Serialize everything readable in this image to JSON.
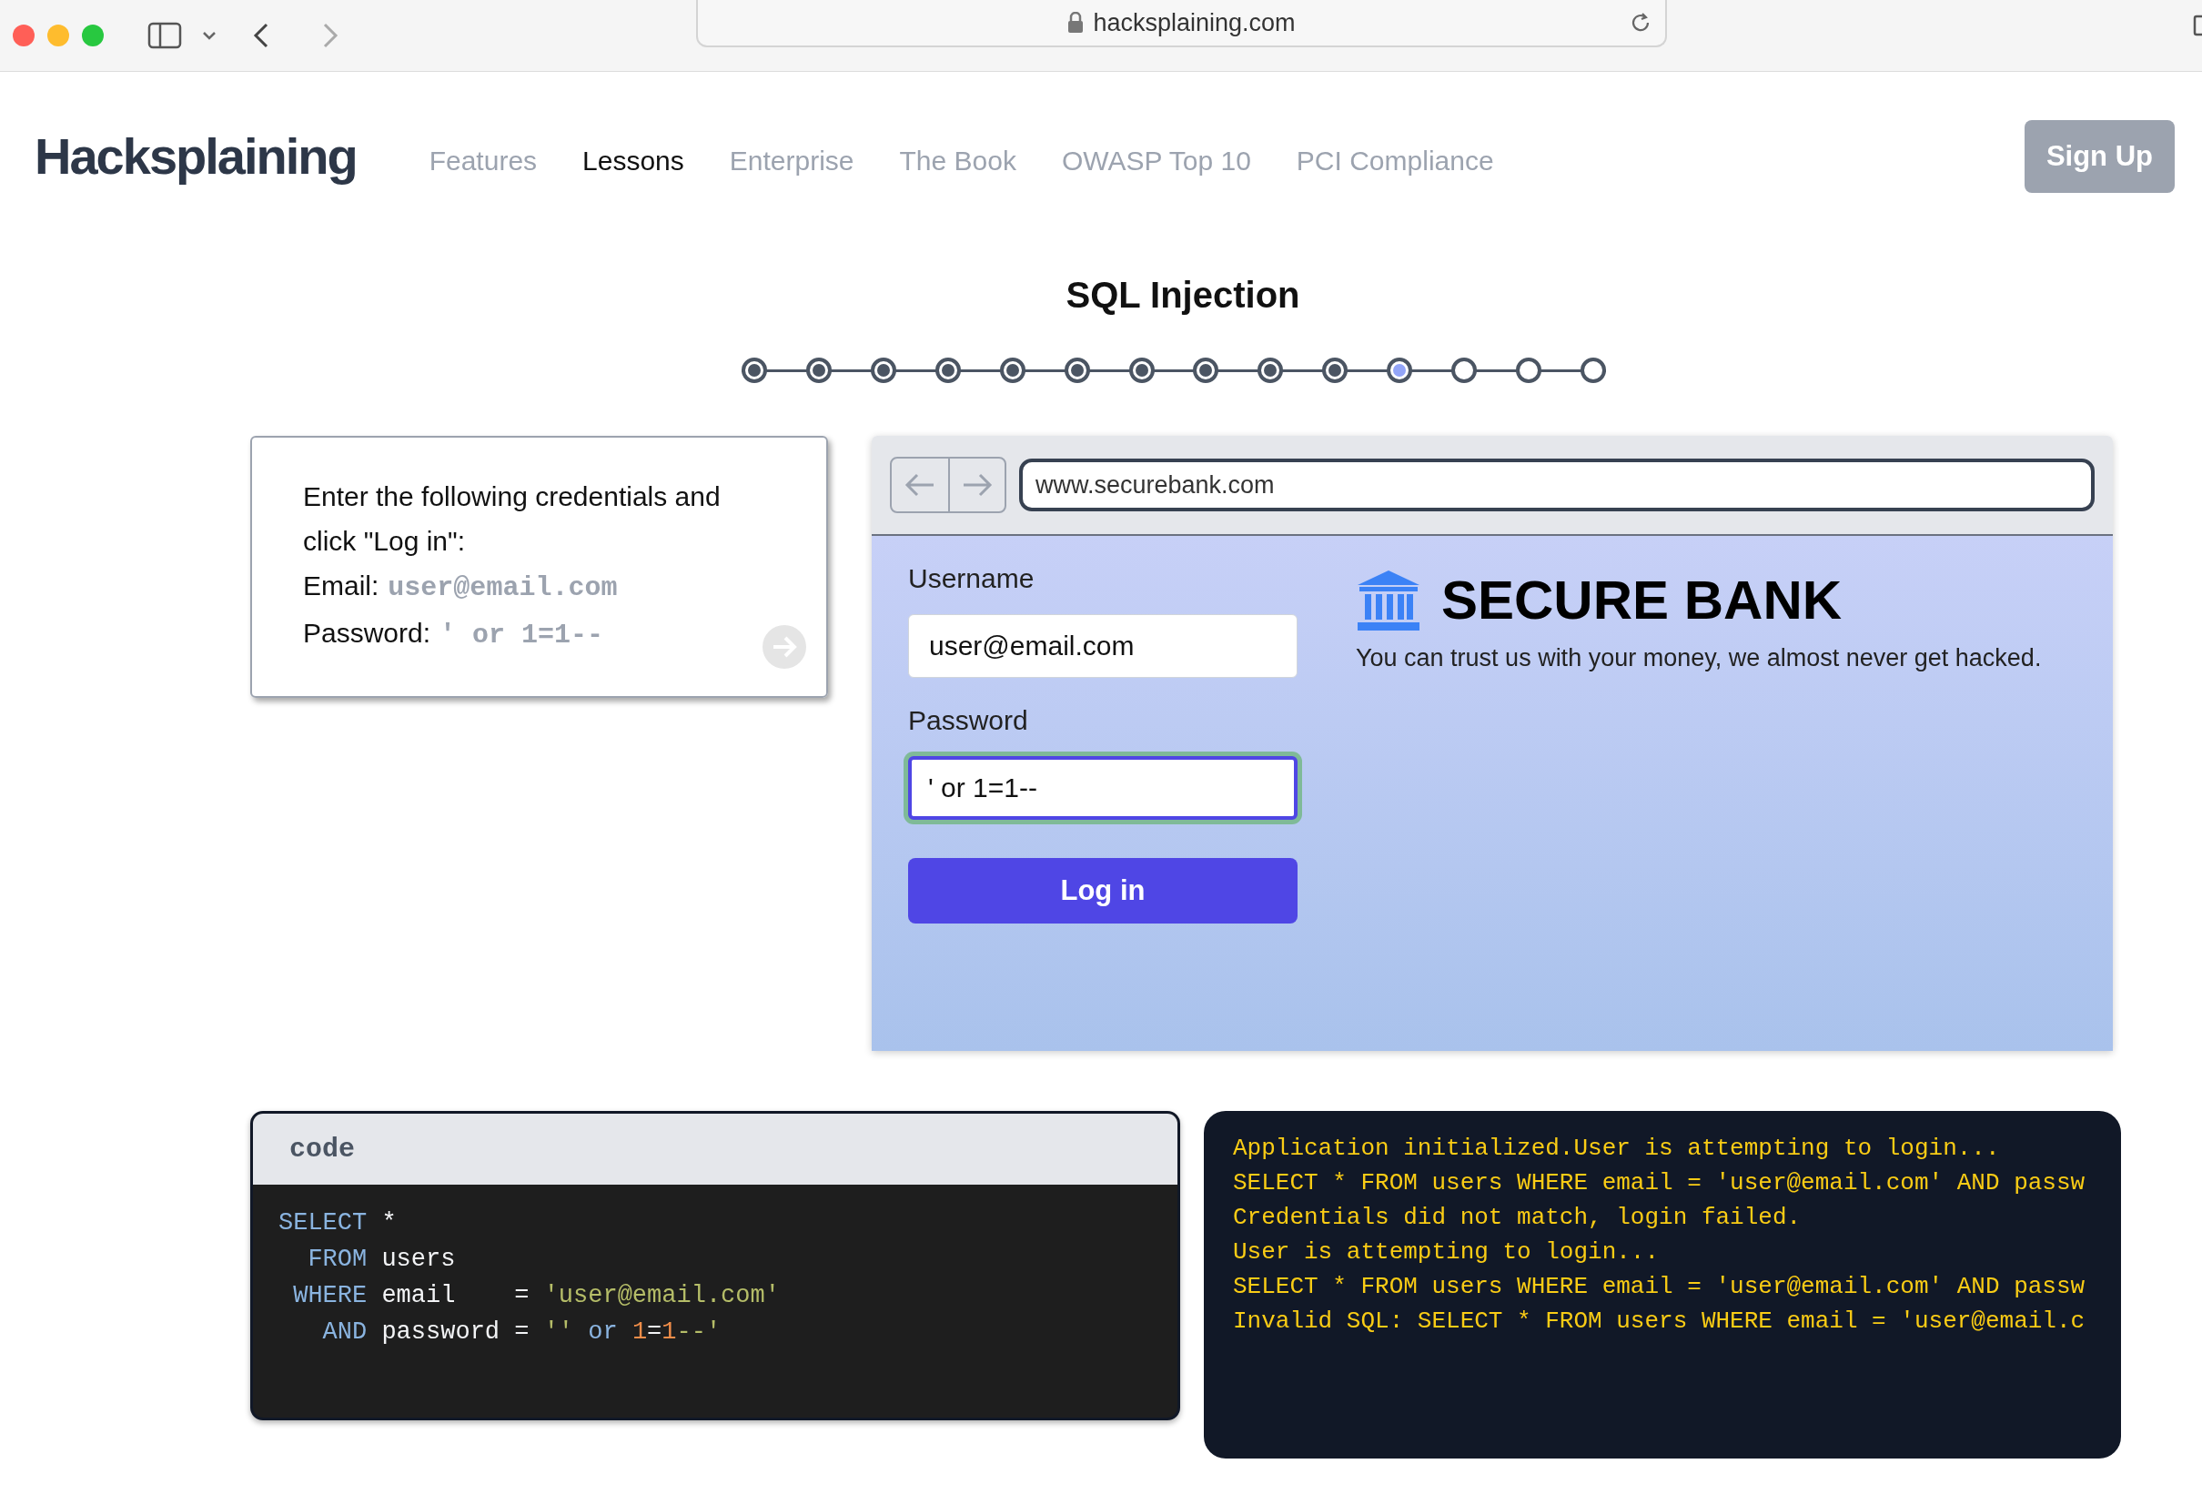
{
  "browser": {
    "url": "hacksplaining.com"
  },
  "header": {
    "logo": "Hacksplaining",
    "nav": [
      {
        "label": "Features",
        "selected": false
      },
      {
        "label": "Lessons",
        "selected": true
      },
      {
        "label": "Enterprise",
        "selected": false
      },
      {
        "label": "The Book",
        "selected": false
      },
      {
        "label": "OWASP Top 10",
        "selected": false
      },
      {
        "label": "PCI Compliance",
        "selected": false
      }
    ],
    "signup": "Sign Up"
  },
  "lesson": {
    "title": "SQL Injection",
    "steps": [
      {
        "done": true,
        "selected": false
      },
      {
        "done": true,
        "selected": false
      },
      {
        "done": true,
        "selected": false
      },
      {
        "done": true,
        "selected": false
      },
      {
        "done": true,
        "selected": false
      },
      {
        "done": true,
        "selected": false
      },
      {
        "done": true,
        "selected": false
      },
      {
        "done": true,
        "selected": false
      },
      {
        "done": true,
        "selected": false
      },
      {
        "done": true,
        "selected": false
      },
      {
        "done": false,
        "selected": true
      },
      {
        "done": false,
        "selected": false
      },
      {
        "done": false,
        "selected": false
      },
      {
        "done": false,
        "selected": false
      }
    ]
  },
  "instructions": {
    "text": "Enter the following credentials and click \"Log in\":",
    "email_label": "Email:",
    "email_value": "user@email.com",
    "password_label": "Password:",
    "password_value": "' or 1=1--"
  },
  "mock_browser": {
    "url": "www.securebank.com",
    "form": {
      "username_label": "Username",
      "username_value": "user@email.com",
      "password_label": "Password",
      "password_value": "' or 1=1--",
      "password_focused": true,
      "submit": "Log in"
    },
    "bank_name": "SECURE BANK",
    "tagline": "You can trust us with your money, we almost never get hacked."
  },
  "code_panel": {
    "title": "code",
    "lines": [
      [
        {
          "kind": "keyword",
          "text": "SELECT"
        },
        {
          "kind": "plain",
          "text": " *"
        }
      ],
      [
        {
          "kind": "keyword",
          "text": "  FROM"
        },
        {
          "kind": "plain",
          "text": " users"
        }
      ],
      [
        {
          "kind": "keyword",
          "text": " WHERE"
        },
        {
          "kind": "plain",
          "text": " email    = "
        },
        {
          "kind": "string",
          "text": "'user@email.com'"
        }
      ],
      [
        {
          "kind": "keyword",
          "text": "   AND"
        },
        {
          "kind": "plain",
          "text": " password = "
        },
        {
          "kind": "string",
          "text": "''"
        },
        {
          "kind": "keyword",
          "text": " or "
        },
        {
          "kind": "number",
          "text": "1"
        },
        {
          "kind": "plain",
          "text": "="
        },
        {
          "kind": "number",
          "text": "1"
        },
        {
          "kind": "string",
          "text": "--'"
        }
      ]
    ]
  },
  "console": {
    "lines": [
      "Application initialized.User is attempting to login...",
      "SELECT * FROM users WHERE email = 'user@email.com' AND passw",
      "Credentials did not match, login failed.",
      "User is attempting to login...",
      "SELECT * FROM users WHERE email = 'user@email.com' AND passw",
      "Invalid SQL: SELECT * FROM users WHERE email = 'user@email.c"
    ]
  }
}
